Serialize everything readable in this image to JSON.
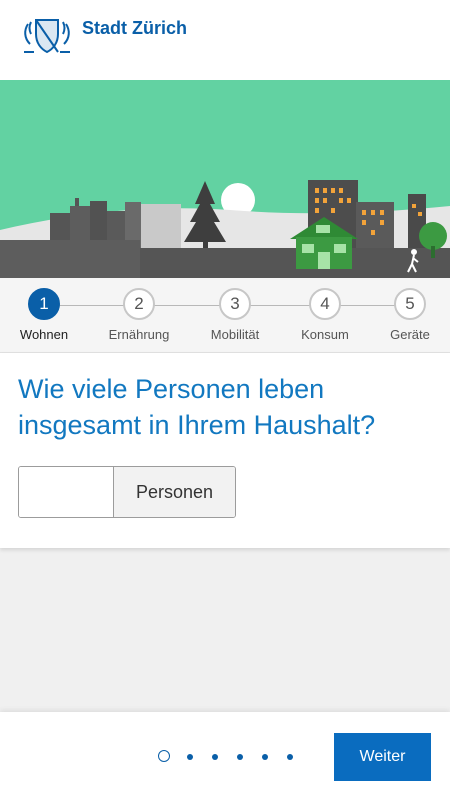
{
  "header": {
    "brand": "Stadt Zürich"
  },
  "steps": [
    {
      "number": "1",
      "label": "Wohnen",
      "active": true
    },
    {
      "number": "2",
      "label": "Ernährung",
      "active": false
    },
    {
      "number": "3",
      "label": "Mobilität",
      "active": false
    },
    {
      "number": "4",
      "label": "Konsum",
      "active": false
    },
    {
      "number": "5",
      "label": "Geräte",
      "active": false
    }
  ],
  "question": {
    "text": "Wie viele Personen leben insgesamt in Ihrem Haushalt?",
    "input_value": "",
    "unit": "Personen"
  },
  "footer": {
    "page_count": 6,
    "current_page": 1,
    "next_label": "Weiter"
  },
  "colors": {
    "brand_blue": "#0a5fa8",
    "question_blue": "#1278c0",
    "hero_green": "#62d2a2"
  }
}
